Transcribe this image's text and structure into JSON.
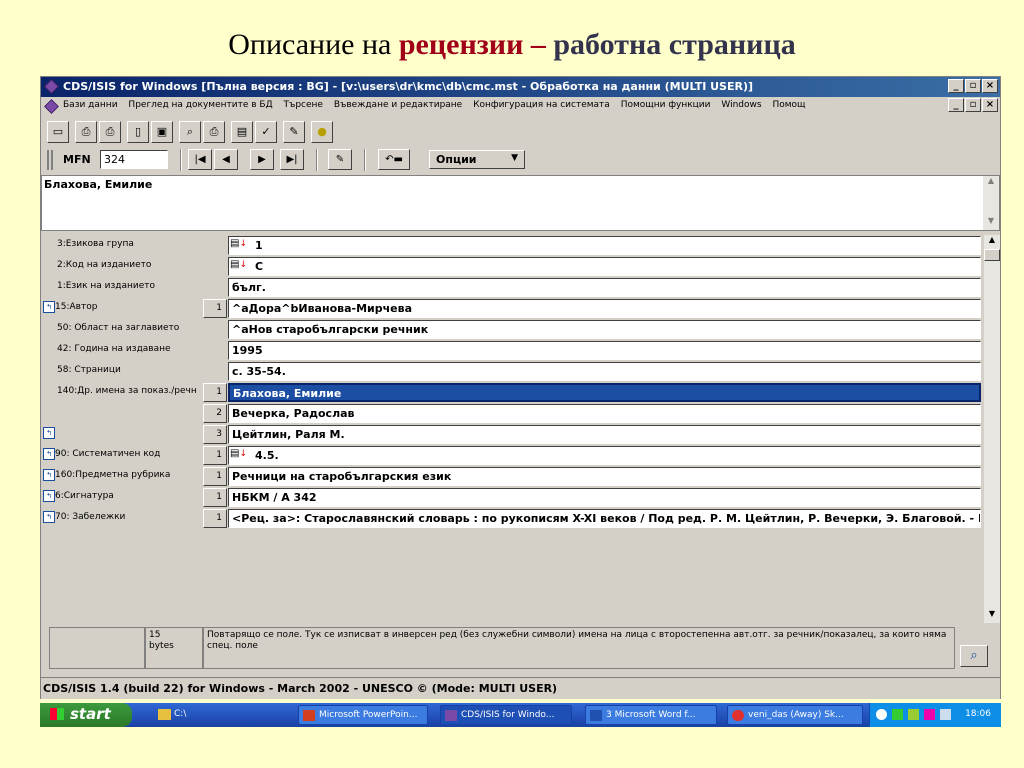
{
  "slide": {
    "title_part1": "Описание на ",
    "title_part2": "рецензии",
    "title_part3": " – ",
    "title_part4": "работна страница"
  },
  "window": {
    "title": "CDS/ISIS for Windows [Пълна версия : BG] - [v:\\users\\dr\\kmc\\db\\cmc.mst - Обработка на данни (MULTI USER)]",
    "controls": [
      "_",
      "▫",
      "×"
    ]
  },
  "menu": {
    "items": [
      "Бази данни",
      "Преглед на документите в БД",
      "Търсене",
      "Въвеждане и редактиране",
      "Конфигурация на системата",
      "Помощни функции",
      "Windows",
      "Помощ"
    ]
  },
  "nav": {
    "mfn_label": "MFN",
    "mfn_value": "324",
    "options_label": "Опции"
  },
  "header_value": "Блахова, Емилие",
  "fields": [
    {
      "label": "3:Езикова група",
      "occ": "",
      "value": "1",
      "pick": true,
      "icon": false
    },
    {
      "label": "2:Код на изданието",
      "occ": "",
      "value": "C",
      "pick": true,
      "icon": false
    },
    {
      "label": "1:Език на изданието",
      "occ": "",
      "value": "бълг.",
      "pick": false,
      "icon": false
    },
    {
      "label": "15:Автор",
      "occ": "1",
      "value": "^aДора^bИванова-Мирчева",
      "pick": false,
      "icon": true
    },
    {
      "label": "50: Област на заглавието",
      "occ": "",
      "value": "^aНов старобългарски речник",
      "pick": false,
      "icon": false
    },
    {
      "label": "42: Година на издаване",
      "occ": "",
      "value": "1995",
      "pick": false,
      "icon": false
    },
    {
      "label": "58: Страници",
      "occ": "",
      "value": "с. 35-54.",
      "pick": false,
      "icon": false
    },
    {
      "label": "140:Др. имена за показ./речн",
      "occ": "1",
      "value": "Блахова, Емилие",
      "pick": false,
      "icon": false,
      "selected": true
    },
    {
      "label": "",
      "occ": "2",
      "value": "Вечерка, Радослав",
      "pick": false,
      "icon": false
    },
    {
      "label": "",
      "occ": "3",
      "value": "Цейтлин, Раля М.",
      "pick": false,
      "icon": true
    },
    {
      "label": "90: Систематичен код",
      "occ": "1",
      "value": "4.5.",
      "pick": true,
      "icon": true
    },
    {
      "label": "160:Предметна рубрика",
      "occ": "1",
      "value": "Речници на старобългарския език",
      "pick": false,
      "icon": true
    },
    {
      "label": "6:Сигнатура",
      "occ": "1",
      "value": "НБКМ / А 342",
      "pick": false,
      "icon": true
    },
    {
      "label": "70: Забележки",
      "occ": "1",
      "value": "<Рец. за>: Старославянский словарь : по рукописям X-XI веков / Под ред. Р. М. Цейтлин, Р. Вечерки, Э. Благовой. - Мос",
      "pick": false,
      "icon": true
    }
  ],
  "status": {
    "size_line1": "15",
    "size_line2": "bytes",
    "help": "Повтарящо се поле. Тук се изписват в инверсен ред (без служебни символи) имена на лица с второстепенна авт.отг. за речник/показалец, за които няма спец. поле"
  },
  "bottombar": "CDS/ISIS 1.4 (build 22) for Windows - March 2002 - UNESCO © (Mode: MULTI USER)",
  "taskbar": {
    "start": "start",
    "quick": "C:\\",
    "items": [
      {
        "label": "Microsoft PowerPoin...",
        "color": "#d04020"
      },
      {
        "label": "CDS/ISIS for Windo...",
        "color": "#7a4aa8"
      },
      {
        "label": "3 Microsoft Word f...",
        "color": "#2050b0"
      },
      {
        "label": "veni_das (Away) Sk...",
        "color": "#e03030"
      }
    ],
    "clock": "18:06"
  }
}
